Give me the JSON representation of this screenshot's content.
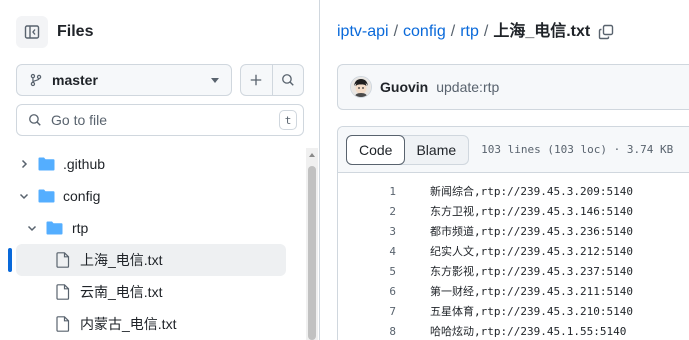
{
  "sidebar": {
    "title": "Files",
    "branch": "master",
    "search_placeholder": "Go to file",
    "search_shortcut": "t",
    "tree": [
      {
        "label": ".github",
        "type": "folder",
        "depth": 0,
        "expanded": false
      },
      {
        "label": "config",
        "type": "folder",
        "depth": 0,
        "expanded": true
      },
      {
        "label": "rtp",
        "type": "folder",
        "depth": 1,
        "expanded": true
      },
      {
        "label": "上海_电信.txt",
        "type": "file",
        "depth": 2,
        "selected": true
      },
      {
        "label": "云南_电信.txt",
        "type": "file",
        "depth": 2
      },
      {
        "label": "内蒙古_电信.txt",
        "type": "file",
        "depth": 2
      }
    ]
  },
  "breadcrumb": {
    "repo": "iptv-api",
    "parts": [
      "config",
      "rtp"
    ],
    "current": "上海_电信.txt"
  },
  "commit": {
    "author": "Guovin",
    "message": "update:rtp"
  },
  "file": {
    "tab_code": "Code",
    "tab_blame": "Blame",
    "meta": "103 lines (103 loc) · 3.74 KB",
    "lines": [
      {
        "n": "1",
        "text": "新闻综合,rtp://239.45.3.209:5140"
      },
      {
        "n": "2",
        "text": "东方卫视,rtp://239.45.3.146:5140"
      },
      {
        "n": "3",
        "text": "都市频道,rtp://239.45.3.236:5140"
      },
      {
        "n": "4",
        "text": "纪实人文,rtp://239.45.3.212:5140"
      },
      {
        "n": "5",
        "text": "东方影视,rtp://239.45.3.237:5140"
      },
      {
        "n": "6",
        "text": "第一财经,rtp://239.45.3.211:5140"
      },
      {
        "n": "7",
        "text": "五星体育,rtp://239.45.3.210:5140"
      },
      {
        "n": "8",
        "text": "哈哈炫动,rtp://239.45.1.55:5140"
      }
    ]
  },
  "colors": {
    "accent": "#0969da",
    "folder": "#54aeff",
    "muted": "#59636e",
    "border": "#d0d7de"
  }
}
